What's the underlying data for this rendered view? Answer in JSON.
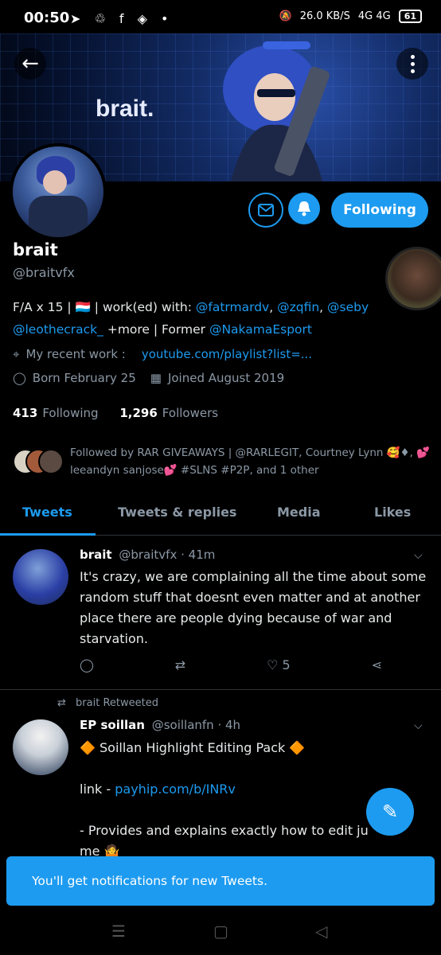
{
  "status_bar": {
    "time": "00:50",
    "left_icons": "➤ ♲ f ◈ •",
    "speed": "26.0 KB/S",
    "network": "4G 4G",
    "battery": "61"
  },
  "banner": {
    "brand_text": "brait."
  },
  "header": {
    "back_icon": "arrow-left-icon",
    "more_icon": "more-vertical-icon"
  },
  "actions": {
    "message_icon": "mail-icon",
    "bell_icon": "bell-check-icon",
    "following_label": "Following"
  },
  "profile": {
    "name": "brait",
    "handle": "@braitvfx",
    "bio_parts": {
      "p1": "F/A x 15 | 🇱🇺 | work(ed) with: ",
      "m1": "@fatrmardv",
      "s1": ", ",
      "m2": "@zqfin",
      "s2": ", ",
      "m3": "@seby",
      "s3": " ",
      "m4": "@leothecrack_",
      "p2": " +more | Former ",
      "m5": "@NakamaEsport"
    },
    "location_label": "My recent work :",
    "location_link": "youtube.com/playlist?list=...",
    "birthday": "Born February 25",
    "joined": "Joined August 2019",
    "following_count": "413",
    "following_label": "Following",
    "followers_count": "1,296",
    "followers_label": "Followers",
    "followed_by": "Followed by RAR GIVEAWAYS | @RARLEGIT, Courtney Lynn 🥰♦, 💕leeandyn sanjose💕 #SLNS #P2P, and 1 other"
  },
  "tabs": [
    "Tweets",
    "Tweets & replies",
    "Media",
    "Likes"
  ],
  "tweets": [
    {
      "name": "brait",
      "handle": "@braitvfx",
      "time": "· 41m",
      "text": "It's crazy, we are complaining all the time about some random stuff that doesnt even matter and at another place there are people dying because of war and starvation.",
      "likes": "5"
    },
    {
      "retweet_label": "brait Retweeted",
      "name": "EP soillan",
      "handle": "@soillanfn",
      "time": "· 4h",
      "line1": "🔶 Soillan Highlight Editing Pack 🔶",
      "link_prefix": "link - ",
      "link": "payhip.com/b/INRv",
      "line3": "- Provides and explains exactly how to edit ju",
      "line4": "me 🤷"
    }
  ],
  "toast": "You'll get notifications for new Tweets.",
  "compose_icon": "compose-tweet-icon"
}
